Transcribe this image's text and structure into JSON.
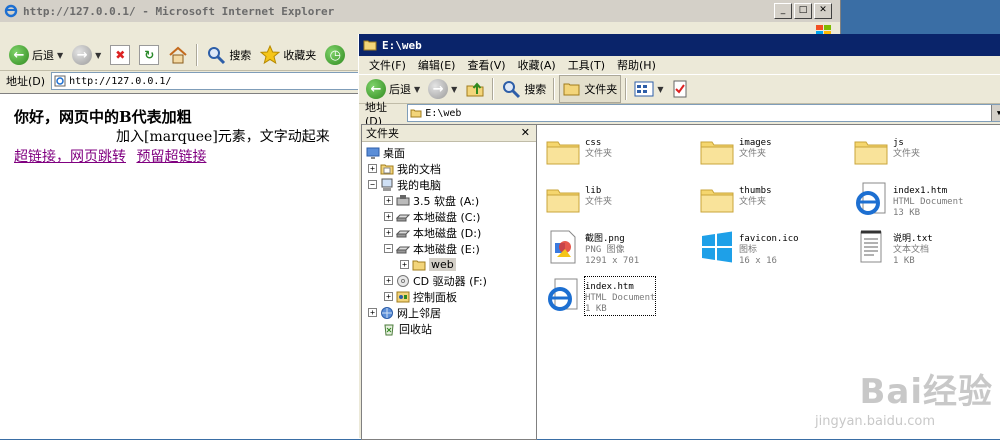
{
  "ie": {
    "title": "http://127.0.0.1/ - Microsoft Internet Explorer",
    "toolbar": {
      "back": "后退",
      "search": "搜索",
      "favorites": "收藏夹"
    },
    "address_label": "地址(D)",
    "address_value": "http://127.0.0.1/",
    "content": {
      "heading": "你好，网页中的B代表加粗",
      "marquee": "加入[marquee]元素，文字动起来",
      "link1": "超链接，网页跳转",
      "link2": "预留超链接"
    }
  },
  "explorer": {
    "title": "E:\\web",
    "menu": [
      "文件(F)",
      "编辑(E)",
      "查看(V)",
      "收藏(A)",
      "工具(T)",
      "帮助(H)"
    ],
    "toolbar": {
      "back": "后退",
      "search": "搜索",
      "folders": "文件夹"
    },
    "address_label": "地址(D)",
    "address_value": "E:\\web",
    "folders_pane_title": "文件夹",
    "tree": {
      "desktop": "桌面",
      "my_documents": "我的文档",
      "my_computer": "我的电脑",
      "floppy": "3.5 软盘 (A:)",
      "disk_c": "本地磁盘 (C:)",
      "disk_d": "本地磁盘 (D:)",
      "disk_e": "本地磁盘 (E:)",
      "web": "web",
      "cd": "CD 驱动器 (F:)",
      "control_panel": "控制面板",
      "network": "网上邻居",
      "recycle": "回收站"
    },
    "files": [
      {
        "name": "css",
        "line2": "文件夹",
        "line3": "",
        "icon": "folder-icon"
      },
      {
        "name": "images",
        "line2": "文件夹",
        "line3": "",
        "icon": "folder-icon"
      },
      {
        "name": "js",
        "line2": "文件夹",
        "line3": "",
        "icon": "folder-icon"
      },
      {
        "name": "lib",
        "line2": "文件夹",
        "line3": "",
        "icon": "folder-icon"
      },
      {
        "name": "thumbs",
        "line2": "文件夹",
        "line3": "",
        "icon": "folder-icon"
      },
      {
        "name": "index1.htm",
        "line2": "HTML Document",
        "line3": "13 KB",
        "icon": "ie-document-icon"
      },
      {
        "name": "截图.png",
        "line2": "PNG 图像",
        "line3": "1291 x 701",
        "icon": "png-image-icon"
      },
      {
        "name": "favicon.ico",
        "line2": "图标",
        "line3": "16 x 16",
        "icon": "windows-logo-icon"
      },
      {
        "name": "说明.txt",
        "line2": "文本文档",
        "line3": "1 KB",
        "icon": "text-document-icon"
      },
      {
        "name": "index.htm",
        "line2": "HTML Document",
        "line3": "1 KB",
        "icon": "ie-document-icon"
      }
    ]
  },
  "watermark": {
    "main": "Bai经验",
    "sub": "jingyan.baidu.com"
  }
}
